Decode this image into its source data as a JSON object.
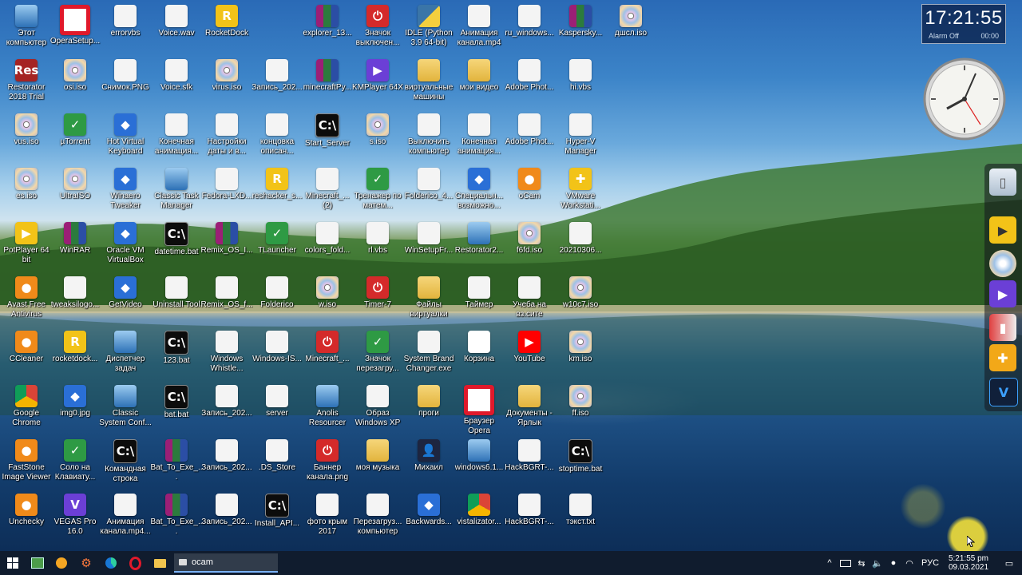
{
  "clock_widget": {
    "time": "17:21:55",
    "alarm": "Alarm Off",
    "alarm_time": "00:00"
  },
  "desktop_icons": [
    [
      "Этот компьютер",
      "OperaSetup...",
      "errorvbs",
      "Voice.wav",
      "RocketDock",
      "",
      "explorer_13...",
      "Значок выключен...",
      "IDLE (Python 3.9 64-bit)",
      "Анимация канала.mp4",
      "ru_windows...",
      "Kaspersky...",
      "дшсл.iso"
    ],
    [
      "Restorator 2018 Trial",
      "osi.iso",
      "Снимок.PNG",
      "Voice.sfk",
      "virus.iso",
      "Запись_202...",
      "minecraftPy...",
      "KMPlayer 64X",
      "виртуальные машины",
      "мои видео",
      "Adobe Phot...",
      "hi.vbs",
      ""
    ],
    [
      "vus.iso",
      "µTorrent",
      "Hot Virtual Keyboard",
      "Конечная анимация...",
      "Настройки даты и в...",
      "концовка описан...",
      "Start_Server",
      "s.iso",
      "Выключить компьютер",
      "Конечная анимация...",
      "Adobe Phot...",
      "Hyper-V Manager",
      ""
    ],
    [
      "es.iso",
      "UltraISO",
      "Winaero Tweaker",
      "Classic Task Manager",
      "Fedora-LXD...",
      "reshacker_s...",
      "Minecraft_... (2)",
      "Тренажер по матем...",
      "Folderico_4...",
      "Специальн... возможно...",
      "oCam",
      "VMware Workstati...",
      ""
    ],
    [
      "PotPlayer 64 bit",
      "WinRAR",
      "Oracle VM VirtualBox",
      "datetime.bat",
      "Remix_OS_I...",
      "TLauncher",
      "colors_fold...",
      "rl.vbs",
      "WinSetupFr...",
      "Restorator2...",
      "f6fd.iso",
      "20210306...",
      ""
    ],
    [
      "Avast Free Antivirus",
      "tweaksilogo...",
      "GetVideo",
      "Uninstall Tool",
      "Remix_OS_f...",
      "Folderico",
      "w.iso",
      "Timer-7",
      "Файлы виртуалки",
      "Таймер",
      "Учеба на вз.сите",
      "w10c7.iso",
      ""
    ],
    [
      "CCleaner",
      "rocketdock...",
      "Диспетчер задач",
      "123.bat",
      "Windows Whistle...",
      "Windows-IS...",
      "Minecraft_...",
      "Значок перезагру...",
      "System Brand Changer.exe",
      "Корзина",
      "YouTube",
      "km.iso",
      ""
    ],
    [
      "Google Chrome",
      "img0.jpg",
      "Classic System Conf...",
      "bat.bat",
      "Запись_202...",
      "server",
      "Anolis Resourcer",
      "Образ Windows XP",
      "проги",
      "Браузер Opera",
      "Документы - Ярлык",
      "ff.iso",
      ""
    ],
    [
      "FastStone Image Viewer",
      "Соло на Клавиату...",
      "Командная строка",
      "Bat_To_Exe_...",
      "Запись_202...",
      ".DS_Store",
      "Баннер канала.png",
      "моя музыка",
      "Михаил",
      "windows6.1...",
      "HackBGRT-...",
      "stoptime.bat",
      ""
    ],
    [
      "Unchecky",
      "VEGAS Pro 16.0",
      "Анимация канала.mp4...",
      "Bat_To_Exe_...",
      "Запись_202...",
      "Install_API...",
      "фото крым 2017",
      "Перезагруз... компьютер",
      "Backwards...",
      "vistalizator...",
      "HackBGRT-...",
      "тэкст.txt",
      ""
    ]
  ],
  "taskbar": {
    "task_label": "ocam",
    "lang": "РУС",
    "time": "5:21:55 pm",
    "date": "09.03.2021"
  }
}
